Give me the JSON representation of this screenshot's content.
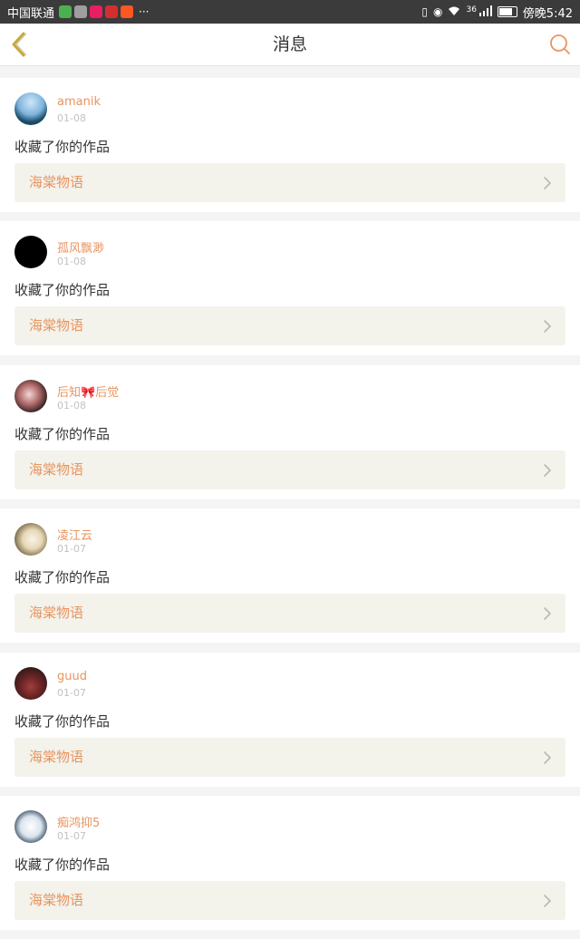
{
  "status_bar": {
    "carrier": "中国联通",
    "more": "···",
    "network": "36",
    "time": "傍晚5:42",
    "battery_level": 0.8,
    "app_icons": [
      "video-app-icon",
      "wechat-icon",
      "message-app-icon",
      "photo-app-icon",
      "play-app-icon"
    ]
  },
  "header": {
    "title": "消息",
    "back_icon": "back-chevron-icon",
    "search_icon": "search-icon"
  },
  "colors": {
    "accent": "#e9945f",
    "back_icon": "#c9a83a",
    "card_link_bg": "#f3f2eb",
    "date": "#c2c2c2"
  },
  "messages": [
    {
      "username": "amanik",
      "date": "01-08",
      "action": "收藏了你的作品",
      "work": "海棠物语",
      "avatar": "avatar-mountain-sky"
    },
    {
      "username": "孤风飘渺",
      "date": "01-08",
      "action": "收藏了你的作品",
      "work": "海棠物语",
      "avatar": "avatar-black-text"
    },
    {
      "username": "后知🎀后觉",
      "date": "01-08",
      "action": "收藏了你的作品",
      "work": "海棠物语",
      "avatar": "avatar-girl-pink"
    },
    {
      "username": "凌江云",
      "date": "01-07",
      "action": "收藏了你的作品",
      "work": "海棠物语",
      "avatar": "avatar-girl-white"
    },
    {
      "username": "guud",
      "date": "01-07",
      "action": "收藏了你的作品",
      "work": "海棠物语",
      "avatar": "avatar-car-red"
    },
    {
      "username": "痴鸿抑5",
      "date": "01-07",
      "action": "收藏了你的作品",
      "work": "海棠物语",
      "avatar": "avatar-penguins"
    }
  ]
}
